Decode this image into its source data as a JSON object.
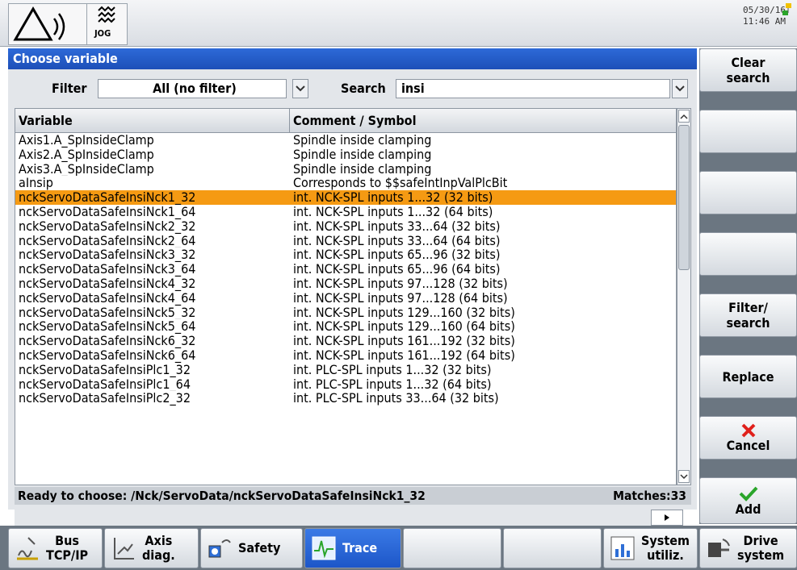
{
  "header": {
    "mode_label": "JOG",
    "date": "05/30/16",
    "time": "11:46 AM"
  },
  "dialog": {
    "title": "Choose variable",
    "filter_label": "Filter",
    "filter_value": "All (no filter)",
    "search_label": "Search",
    "search_value": "insi"
  },
  "table": {
    "columns": [
      "Variable",
      "Comment / Symbol"
    ],
    "rows": [
      [
        "Axis1.A_SpInsideClamp",
        "Spindle inside clamping"
      ],
      [
        "Axis2.A_SpInsideClamp",
        "Spindle inside clamping"
      ],
      [
        "Axis3.A_SpInsideClamp",
        "Spindle inside clamping"
      ],
      [
        "aInsip",
        "Corresponds to $$safeIntInpValPlcBit"
      ],
      [
        "nckServoDataSafeInsiNck1_32",
        "int. NCK-SPL inputs 1...32 (32 bits)"
      ],
      [
        "nckServoDataSafeInsiNck1_64",
        "int. NCK-SPL inputs 1...32 (64 bits)"
      ],
      [
        "nckServoDataSafeInsiNck2_32",
        "int. NCK-SPL inputs 33...64 (32 bits)"
      ],
      [
        "nckServoDataSafeInsiNck2_64",
        "int. NCK-SPL inputs 33...64 (64 bits)"
      ],
      [
        "nckServoDataSafeInsiNck3_32",
        "int. NCK-SPL inputs 65...96 (32 bits)"
      ],
      [
        "nckServoDataSafeInsiNck3_64",
        "int. NCK-SPL inputs 65...96 (64 bits)"
      ],
      [
        "nckServoDataSafeInsiNck4_32",
        "int. NCK-SPL inputs 97...128 (32 bits)"
      ],
      [
        "nckServoDataSafeInsiNck4_64",
        "int. NCK-SPL inputs 97...128 (64 bits)"
      ],
      [
        "nckServoDataSafeInsiNck5_32",
        "int. NCK-SPL inputs 129...160 (32 bits)"
      ],
      [
        "nckServoDataSafeInsiNck5_64",
        "int. NCK-SPL inputs 129...160 (64 bits)"
      ],
      [
        "nckServoDataSafeInsiNck6_32",
        "int. NCK-SPL inputs 161...192 (32 bits)"
      ],
      [
        "nckServoDataSafeInsiNck6_64",
        "int. NCK-SPL inputs 161...192 (64 bits)"
      ],
      [
        "nckServoDataSafeInsiPlc1_32",
        "int. PLC-SPL inputs 1...32 (32 bits)"
      ],
      [
        "nckServoDataSafeInsiPlc1_64",
        "int. PLC-SPL inputs 1...32 (64 bits)"
      ],
      [
        "nckServoDataSafeInsiPlc2_32",
        "int. PLC-SPL inputs 33...64 (32 bits)"
      ]
    ],
    "selected_index": 4
  },
  "status": {
    "text": "Ready to choose: /Nck/ServoData/nckServoDataSafeInsiNck1_32",
    "matches": "Matches:33"
  },
  "softkeys_vertical": {
    "clear_search": [
      "Clear",
      "search"
    ],
    "filter_search": [
      "Filter/",
      "search"
    ],
    "replace": "Replace",
    "cancel": "Cancel",
    "add": "Add"
  },
  "softkeys_horizontal": {
    "bus": [
      "Bus",
      "TCP/IP"
    ],
    "axis": [
      "Axis",
      "diag."
    ],
    "safety": "Safety",
    "trace": "Trace",
    "system": [
      "System",
      "utiliz."
    ],
    "drive": [
      "Drive",
      "system"
    ]
  },
  "colors": {
    "title_blue": "#1d4fb8",
    "selection_orange": "#f59a13",
    "cancel_red": "#e0201b",
    "add_green": "#2aa52a"
  }
}
